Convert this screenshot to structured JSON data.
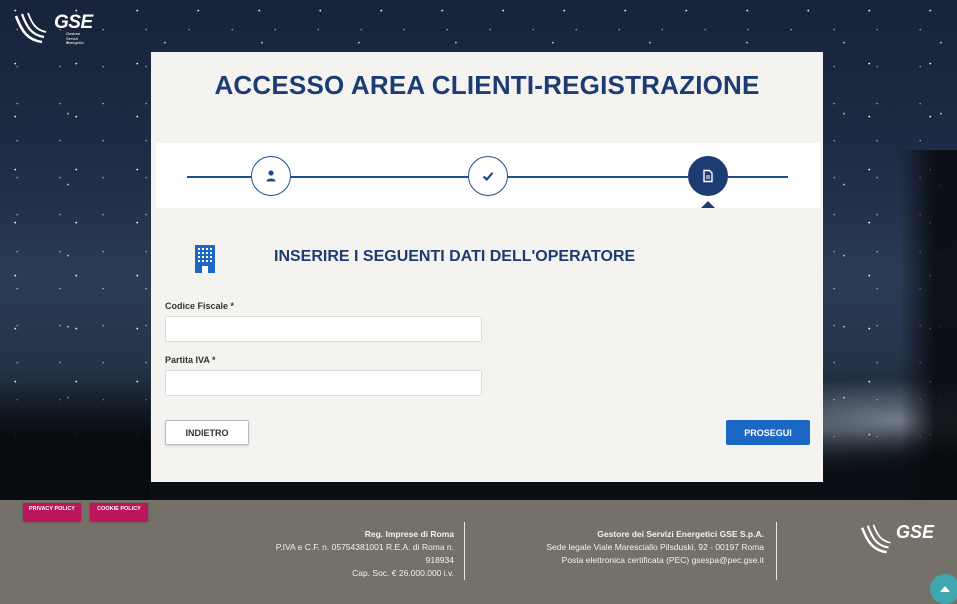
{
  "header": {
    "logo_text": "GSE",
    "logo_sub": [
      "Gestore",
      "Servizi",
      "Energetici"
    ]
  },
  "page": {
    "title": "ACCESSO AREA CLIENTI-REGISTRAZIONE"
  },
  "steps": {
    "icons": [
      "user-icon",
      "check-icon",
      "document-icon"
    ],
    "active_step": 3
  },
  "section": {
    "icon": "building-icon",
    "title": "INSERIRE I SEGUENTI DATI DELL'OPERATORE"
  },
  "form": {
    "codice_fiscale_label": "Codice Fiscale *",
    "codice_fiscale_value": "",
    "partita_iva_label": "Partita IVA *",
    "partita_iva_value": ""
  },
  "buttons": {
    "back": "INDIETRO",
    "next": "PROSEGUI"
  },
  "footer": {
    "privacy_policy": "PRIVACY POLICY",
    "cookie_policy": "COOKIE POLICY",
    "col1_title": "Reg. Imprese di Roma",
    "col1_line1": "P.IVA e C.F. n. 05754381001 R.E.A. di Roma n.",
    "col1_line2": "918934",
    "col1_line3": "Cap. Soc. € 26.000.000 i.v.",
    "col2_title": "Gestore dei Servizi Energetici GSE S.p.A.",
    "col2_line1": "Sede legale Viale Maresciallo Pilsduski, 92 - 00197 Roma",
    "col2_line2": "Posta elettronica certificata (PEC) gsespa@pec.gse.it",
    "logo_text": "GSE"
  },
  "colors": {
    "primary_navy": "#1d3c73",
    "button_blue": "#1a67c4",
    "policy_magenta": "#b9165c",
    "footer_gray": "#757068"
  }
}
